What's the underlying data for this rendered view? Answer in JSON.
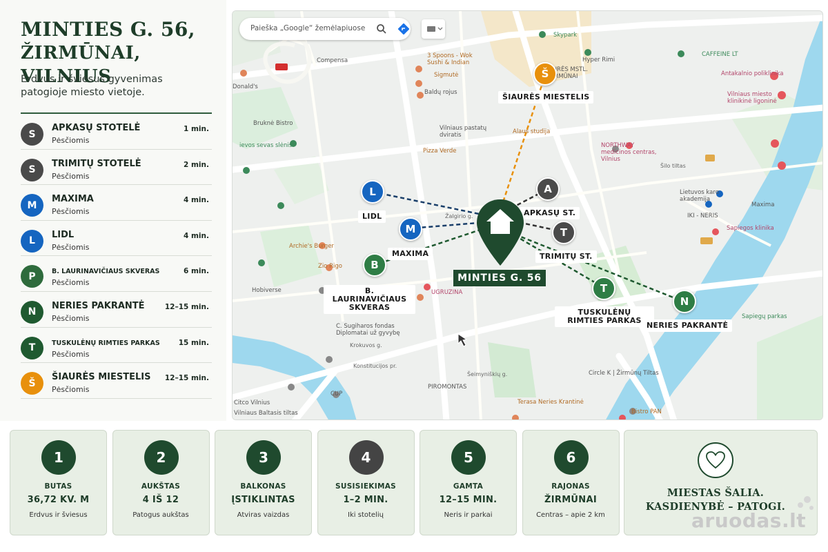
{
  "header": {
    "title_line1": "MINTIES G. 56,",
    "title_line2": "ŽIRMŪNAI, VILNIUS",
    "subtitle": "Erdvus ir šviesus gyvenimas patogioje miesto vietoje."
  },
  "poi_list": [
    {
      "letter": "S",
      "name": "APKASŲ STOTELĖ",
      "mode": "Pėsčiomis",
      "time": "1 min.",
      "color": "#4a4a4a"
    },
    {
      "letter": "S",
      "name": "TRIMITŲ STOTELĖ",
      "mode": "Pėsčiomis",
      "time": "2 min.",
      "color": "#4a4a4a"
    },
    {
      "letter": "M",
      "name": "MAXIMA",
      "mode": "Pėsčiomis",
      "time": "4 min.",
      "color": "#1565c0"
    },
    {
      "letter": "L",
      "name": "LIDL",
      "mode": "Pėsčiomis",
      "time": "4 min.",
      "color": "#1565c0"
    },
    {
      "letter": "P",
      "name": "B. LAURINAVIČIAUS SKVERAS",
      "mode": "Pėsčiomis",
      "time": "6 min.",
      "color": "#2e6b3c"
    },
    {
      "letter": "N",
      "name": "NERIES PAKRANTĖ",
      "mode": "Pėsčiomis",
      "time": "12–15 min.",
      "color": "#1f5a30"
    },
    {
      "letter": "T",
      "name": "TUSKULĖNŲ RIMTIES PARKAS",
      "mode": "Pėsčiomis",
      "time": "15 min.",
      "color": "#1f5a30"
    },
    {
      "letter": "Š",
      "name": "ŠIAURĖS MIESTELIS",
      "mode": "Pėsčiomis",
      "time": "12–15 min.",
      "color": "#e8900c"
    }
  ],
  "map": {
    "search_placeholder": "Paieška „Google“ žemėlapiuose",
    "main_label": "MINTIES G. 56",
    "pins": [
      {
        "letter": "Š",
        "label": "ŠIAURĖS MIESTELIS",
        "color": "#e8900c"
      },
      {
        "letter": "A",
        "label": "APKASŲ ST.",
        "color": "#4a4a4a"
      },
      {
        "letter": "T",
        "label": "TRIMITŲ ST.",
        "color": "#4a4a4a"
      },
      {
        "letter": "L",
        "label": "LIDL",
        "color": "#1565c0"
      },
      {
        "letter": "M",
        "label": "MAXIMA",
        "color": "#1565c0"
      },
      {
        "letter": "B",
        "label": "B. LAURINAVIČIAUS SKVERAS",
        "color": "#2e7d45"
      },
      {
        "letter": "T",
        "label": "TUSKULĖNŲ RIMTIES PARKAS",
        "color": "#2e7d45"
      },
      {
        "letter": "N",
        "label": "NERIES PAKRANTĖ",
        "color": "#2e7d45"
      }
    ],
    "places": {
      "skypark": "Skypark",
      "hyper_rimi": "Hyper Rimi",
      "caffeine": "CAFFEINE LT",
      "compensa": "Compensa",
      "spoons": "3 Spoons - Wok Sushi & Indian",
      "sigmute": "Sigmutė",
      "baldu": "Baldų rojus",
      "aures": "AURĖS MSTL. ŽIRMŪNAI",
      "antakalnio": "Antakalnio poliklinika",
      "vilniaus_klinike": "Vilniaus miesto klinikinė ligoninė",
      "donalds": "Donald's",
      "brukne": "Bruknė Bistro",
      "seves": "ievos sevas slėnis",
      "vilniaus_pastatu": "Vilniaus pastatų dviratis",
      "alaus": "Alaus studija",
      "northway": "NORTHWAY medicinos centras, Vilnius",
      "pizza": "Pizza Verde",
      "zalgirio": "Žalgirio g.",
      "elba": "Lietuvos karo akademija",
      "maxima_map": "Maxima",
      "iki_neris": "IKI - NERIS",
      "sapiegos": "Sapiegos klinika",
      "archies": "Archie's Burger",
      "zio": "Zio Rigo",
      "hobiverse": "Hobiverse",
      "ugruzina": "UGRUZINA",
      "sugiharos": "C. Sugiharos fondas Diplomatai už gyvybę",
      "cup": "CUP",
      "citco": "Citco Vilnius",
      "baltasis": "Vilniaus Baltasis tiltas",
      "piromontas": "PIROMONTAS",
      "circle_k": "Circle K | Žirmūnų Tiltas",
      "terasa": "Terasa Neries Krantinė",
      "bistro_pan": "Bistro PAN",
      "sapiegu_parkas": "Sapiegų parkas",
      "seimyniskiu": "Šeimyniškių g.",
      "konstitucijos": "Konstitucijos pr.",
      "krokuvos": "Krokuvos g.",
      "silo_tiltas": "Šilo tiltas"
    }
  },
  "cards": [
    {
      "num": "1",
      "label": "BUTAS",
      "value": "36,72 KV. M",
      "sub": "Erdvus ir šviesus",
      "color": "#1f4a2e"
    },
    {
      "num": "2",
      "label": "AUKŠTAS",
      "value": "4 IŠ 12",
      "sub": "Patogus aukštas",
      "color": "#1f4a2e"
    },
    {
      "num": "3",
      "label": "BALKONAS",
      "value": "ĮSTIKLINTAS",
      "sub": "Atviras vaizdas",
      "color": "#1f4a2e"
    },
    {
      "num": "4",
      "label": "SUSISIEKIMAS",
      "value": "1–2 MIN.",
      "sub": "Iki stotelių",
      "color": "#444444"
    },
    {
      "num": "5",
      "label": "GAMTA",
      "value": "12–15 MIN.",
      "sub": "Neris ir parkai",
      "color": "#1f4a2e"
    },
    {
      "num": "6",
      "label": "RAJONAS",
      "value": "ŽIRMŪNAI",
      "sub": "Centras – apie 2 km",
      "color": "#1f4a2e"
    }
  ],
  "slogan": {
    "line1": "MIESTAS ŠALIA.",
    "line2": "KASDIENYBĖ – PATOGI."
  },
  "watermark": "aruodas.lt"
}
